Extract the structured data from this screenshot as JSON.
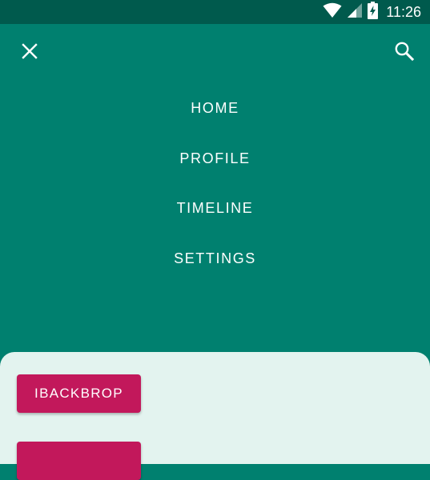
{
  "status_bar": {
    "time": "11:26",
    "icons": [
      "wifi-icon",
      "cell-signal-icon",
      "battery-charging-icon"
    ]
  },
  "app_bar": {
    "left_icon": "close-icon",
    "right_icon": "search-icon"
  },
  "nav": {
    "items": [
      {
        "label": "HOME"
      },
      {
        "label": "PROFILE"
      },
      {
        "label": "TIMELINE"
      },
      {
        "label": "SETTINGS"
      }
    ]
  },
  "front_layer": {
    "button_label": "IBACKBROP",
    "second_button_label": ""
  },
  "colors": {
    "primary": "#00806f",
    "status_bar": "#005a4d",
    "surface": "#e3f3ef",
    "accent": "#c2185b"
  }
}
